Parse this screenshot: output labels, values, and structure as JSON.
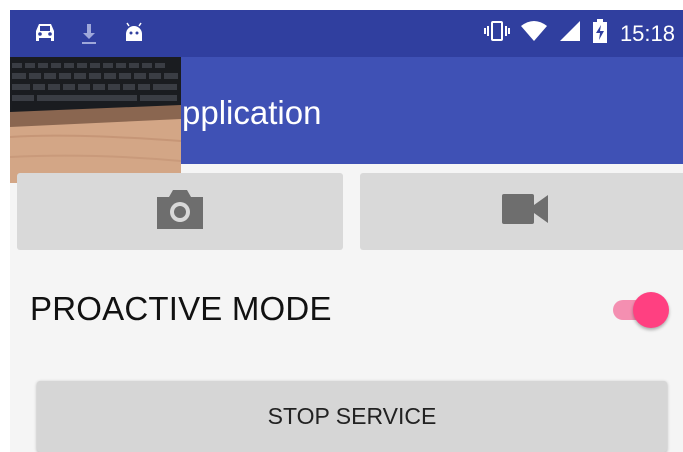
{
  "status_bar": {
    "time": "15:18",
    "left_icons": [
      "car-icon",
      "download-icon",
      "android-icon"
    ],
    "right_icons": [
      "vibrate-icon",
      "wifi-icon",
      "signal-icon",
      "battery-charging-icon"
    ]
  },
  "app_bar": {
    "title_visible": "pplication",
    "color": "#3f51b5"
  },
  "camera_button": {
    "icon": "camera-icon"
  },
  "video_button": {
    "icon": "videocam-icon"
  },
  "proactive_mode": {
    "label": "PROACTIVE MODE",
    "enabled": true,
    "accent": "#ff4081"
  },
  "stop_service_button": {
    "label": "STOP SERVICE"
  }
}
